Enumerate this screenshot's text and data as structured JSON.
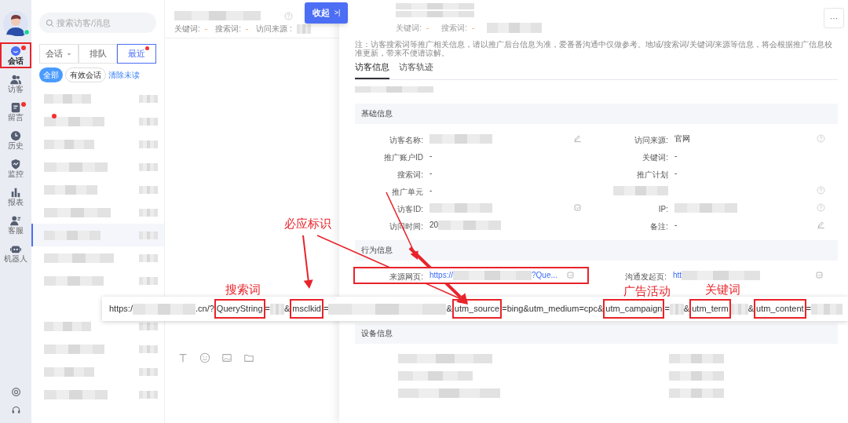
{
  "rail": {
    "items": [
      {
        "label": "会话",
        "selected": true,
        "dot": true,
        "highlighted": true
      },
      {
        "label": "访客",
        "selected": false,
        "dot": false,
        "highlighted": false
      },
      {
        "label": "留言",
        "selected": false,
        "dot": true,
        "highlighted": false
      },
      {
        "label": "历史",
        "selected": false,
        "dot": false,
        "highlighted": false
      },
      {
        "label": "监控",
        "selected": false,
        "dot": false,
        "highlighted": false
      },
      {
        "label": "报表",
        "selected": false,
        "dot": false,
        "highlighted": false
      },
      {
        "label": "客服",
        "selected": false,
        "dot": false,
        "highlighted": false
      },
      {
        "label": "机器人",
        "selected": false,
        "dot": false,
        "highlighted": false
      }
    ]
  },
  "list": {
    "search": {
      "placeholder": "搜索访客/消息"
    },
    "tabs": [
      {
        "kind": "dropdown",
        "label": "会话",
        "selected": false,
        "dot": false
      },
      {
        "kind": "plain",
        "label": "排队",
        "selected": false,
        "dot": false
      },
      {
        "kind": "plain",
        "label": "最近",
        "selected": true,
        "dot": true
      }
    ],
    "filters": [
      {
        "label": "全部",
        "selected": true
      },
      {
        "label": "有效会话",
        "selected": false
      }
    ],
    "clear_link": "清除未读",
    "conversations": [
      {
        "selected": false,
        "unread": false
      },
      {
        "selected": false,
        "unread": true
      },
      {
        "selected": false,
        "unread": false
      },
      {
        "selected": false,
        "unread": false
      },
      {
        "selected": false,
        "unread": false
      },
      {
        "selected": false,
        "unread": false
      },
      {
        "selected": true,
        "unread": false
      },
      {
        "selected": false,
        "unread": false
      },
      {
        "selected": false,
        "unread": false
      }
    ],
    "conversations_below_tooltip": [
      {
        "selected": false,
        "unread": false
      },
      {
        "selected": false,
        "unread": false
      },
      {
        "selected": false,
        "unread": false
      },
      {
        "selected": false,
        "unread": false
      }
    ]
  },
  "chat": {
    "meta": [
      {
        "label": "关键词:",
        "value": "-"
      },
      {
        "label": "搜索词:",
        "value": "-"
      },
      {
        "label": "访问来源 :",
        "blurred": true
      }
    ]
  },
  "collapse_button": {
    "label": "收起",
    "icon": ">|"
  },
  "panel": {
    "meta": [
      {
        "label": "关键词:",
        "value": "-"
      },
      {
        "label": "搜索词:",
        "value": "-"
      },
      {
        "blurred": true
      }
    ],
    "more_button": "···",
    "note": "注：访客搜索词等推广相关信息，请以推广后台信息为准，爱番番沟通中仅做参考。地域/搜索词/关键词/来源等信息，将会根据推广信息校准更新，带来不便请谅解。",
    "tabs": [
      {
        "label": "访客信息",
        "selected": true
      },
      {
        "label": "访客轨迹",
        "selected": false
      }
    ],
    "sections": [
      {
        "title": "基础信息",
        "rows": [
          [
            {
              "kind": "edit",
              "label": "访客名称:",
              "blurred": true
            },
            {
              "kind": "help",
              "label": "访问来源:",
              "value": "官网"
            }
          ],
          [
            {
              "kind": "plain",
              "label": "推广账户ID",
              "value": "-"
            },
            {
              "kind": "plain",
              "label": "关键词:",
              "value": "-"
            }
          ],
          [
            {
              "kind": "plain",
              "label": "搜索词:",
              "value": "-"
            },
            {
              "kind": "plain",
              "label": "推广计划",
              "value": "-"
            }
          ],
          [
            {
              "kind": "plain",
              "label": "推广单元",
              "value": "-"
            },
            {
              "kind": "help",
              "blurred": true
            }
          ],
          [
            {
              "kind": "copy",
              "label": "访客ID:",
              "blurred": true
            },
            {
              "kind": "help",
              "label": "IP:",
              "blurred": true
            }
          ],
          [
            {
              "kind": "plain",
              "label": "访问时间:",
              "value": "20",
              "blurred": true
            },
            {
              "kind": "edit",
              "label": "备注:",
              "value": "-"
            }
          ]
        ]
      },
      {
        "title": "行为信息",
        "rows": [
          [
            {
              "kind": "copy",
              "label": "来源网页:",
              "value": "https://",
              "link": true,
              "blurred": true,
              "tail": "?Que...",
              "highlighted": true
            },
            {
              "kind": "copy",
              "label": "沟通发起页:",
              "value": "htt",
              "link": true,
              "blurred": true,
              "highlighted": false
            }
          ]
        ]
      },
      {
        "title": "设备信息"
      }
    ]
  },
  "url_tooltip": {
    "segments": [
      {
        "text": "https:/"
      },
      {
        "kind": "blur"
      },
      {
        "text": ".cn/?"
      },
      {
        "text": "QueryString",
        "highlighted": true
      },
      {
        "text": "="
      },
      {
        "kind": "blur"
      },
      {
        "text": "&"
      },
      {
        "text": "msclkid",
        "highlighted": true
      },
      {
        "text": "="
      },
      {
        "kind": "blur"
      },
      {
        "text": "&"
      },
      {
        "text": "utm_source",
        "highlighted": true
      },
      {
        "text": "=bing&utm_medium=cpc&"
      },
      {
        "text": "utm_campaign",
        "highlighted": true
      },
      {
        "text": "="
      },
      {
        "kind": "blur"
      },
      {
        "text": "&"
      },
      {
        "text": "utm_term",
        "highlighted": true
      },
      {
        "kind": "blur"
      },
      {
        "text": "&"
      },
      {
        "text": "utm_content",
        "highlighted": true
      },
      {
        "text": "="
      },
      {
        "kind": "blur"
      }
    ]
  },
  "annotations": [
    {
      "text": "必应标识"
    },
    {
      "text": "搜索词"
    },
    {
      "text": "广告活动"
    },
    {
      "text": "关键词"
    }
  ]
}
